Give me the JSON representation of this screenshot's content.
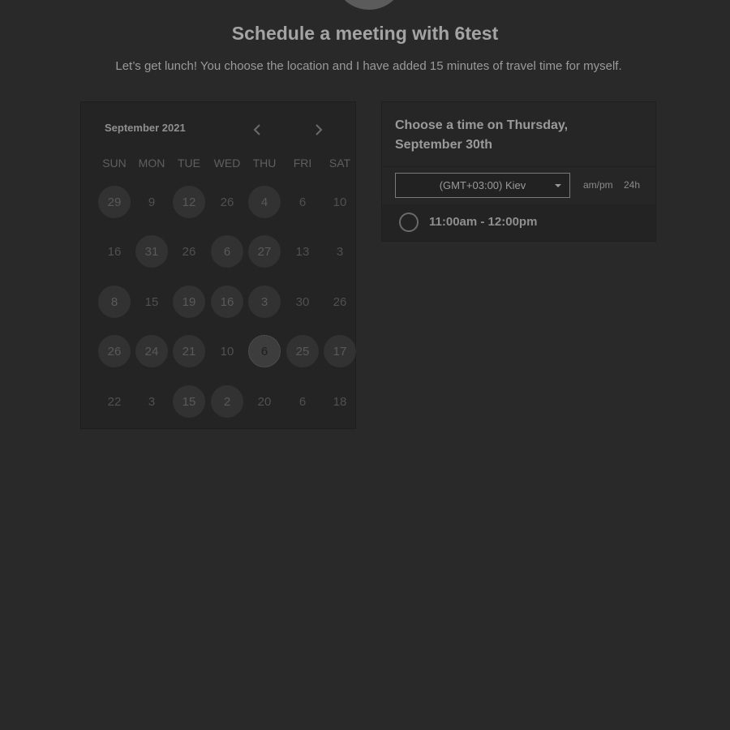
{
  "header": {
    "title": "Schedule a meeting with 6test",
    "subtitle": "Let’s get lunch! You choose the location and I have added 15 minutes of travel time for myself."
  },
  "calendar": {
    "month_label": "September 2021",
    "prev_icon": "chevron-left-icon",
    "next_icon": "chevron-right-icon",
    "weekdays": [
      "SUN",
      "MON",
      "TUE",
      "WED",
      "THU",
      "FRI",
      "SAT"
    ],
    "weeks": [
      [
        {
          "d": "29",
          "a": true
        },
        {
          "d": "9",
          "a": false
        },
        {
          "d": "12",
          "a": true
        },
        {
          "d": "26",
          "a": false
        },
        {
          "d": "4",
          "a": true
        },
        {
          "d": "6",
          "a": false
        },
        {
          "d": "10",
          "a": false
        }
      ],
      [
        {
          "d": "16",
          "a": false
        },
        {
          "d": "31",
          "a": true
        },
        {
          "d": "26",
          "a": false
        },
        {
          "d": "6",
          "a": true
        },
        {
          "d": "27",
          "a": true
        },
        {
          "d": "13",
          "a": false
        },
        {
          "d": "3",
          "a": false
        }
      ],
      [
        {
          "d": "8",
          "a": true
        },
        {
          "d": "15",
          "a": false
        },
        {
          "d": "19",
          "a": true
        },
        {
          "d": "16",
          "a": true
        },
        {
          "d": "3",
          "a": true
        },
        {
          "d": "30",
          "a": false
        },
        {
          "d": "26",
          "a": false
        }
      ],
      [
        {
          "d": "26",
          "a": true
        },
        {
          "d": "24",
          "a": true
        },
        {
          "d": "21",
          "a": true
        },
        {
          "d": "10",
          "a": false
        },
        {
          "d": "6",
          "a": true,
          "selected": true
        },
        {
          "d": "25",
          "a": true
        },
        {
          "d": "17",
          "a": true
        }
      ],
      [
        {
          "d": "22",
          "a": false
        },
        {
          "d": "3",
          "a": false
        },
        {
          "d": "15",
          "a": true
        },
        {
          "d": "2",
          "a": true
        },
        {
          "d": "20",
          "a": false
        },
        {
          "d": "6",
          "a": false
        },
        {
          "d": "18",
          "a": false
        }
      ]
    ]
  },
  "time_panel": {
    "title": "Choose a time on Thursday, September 30th",
    "timezone": "(GMT+03:00) Kiev",
    "format_ampm": "am/pm",
    "format_24h": "24h",
    "slots": [
      "11:00am - 12:00pm"
    ]
  },
  "colors": {
    "background": "#292929",
    "panel": "#242424",
    "text": "#9a9a9a"
  }
}
